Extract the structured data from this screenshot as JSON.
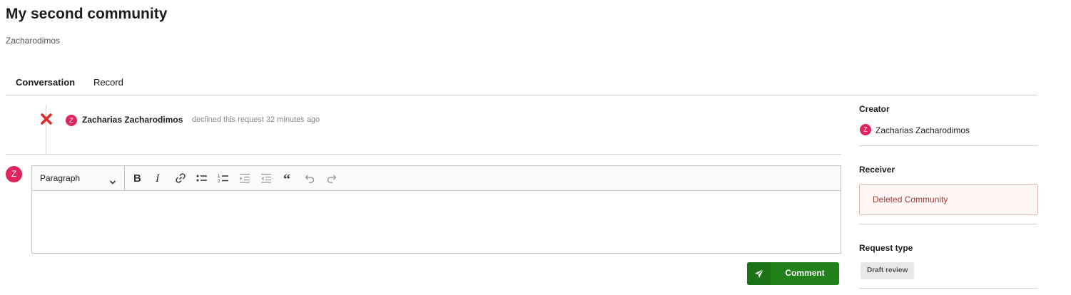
{
  "header": {
    "title": "My second community",
    "subtitle": "Zacharodimos"
  },
  "tabs": [
    {
      "label": "Conversation",
      "active": true
    },
    {
      "label": "Record",
      "active": false
    }
  ],
  "timeline": {
    "event": {
      "icon": "close-icon",
      "avatar_initial": "Z",
      "user": "Zacharias Zacharodimos",
      "action": "declined this request 32 minutes ago"
    }
  },
  "comment_form": {
    "avatar_initial": "Z",
    "toolbar": {
      "paragraph_label": "Paragraph",
      "buttons": [
        "bold-icon",
        "italic-icon",
        "link-icon",
        "bulleted-list-icon",
        "numbered-list-icon",
        "outdent-icon",
        "indent-icon",
        "blockquote-icon",
        "undo-icon",
        "redo-icon"
      ]
    },
    "submit_label": "Comment"
  },
  "sidebar": {
    "creator": {
      "heading": "Creator",
      "avatar_initial": "Z",
      "name": "Zacharias Zacharodimos"
    },
    "receiver": {
      "heading": "Receiver",
      "value": "Deleted Community"
    },
    "request_type": {
      "heading": "Request type",
      "value": "Draft review"
    }
  },
  "colors": {
    "accent_green": "#21821b",
    "avatar_red": "#e0245e",
    "decline_red": "#db2828",
    "error_bg": "#fff6f6",
    "error_text": "#9f3a38"
  }
}
